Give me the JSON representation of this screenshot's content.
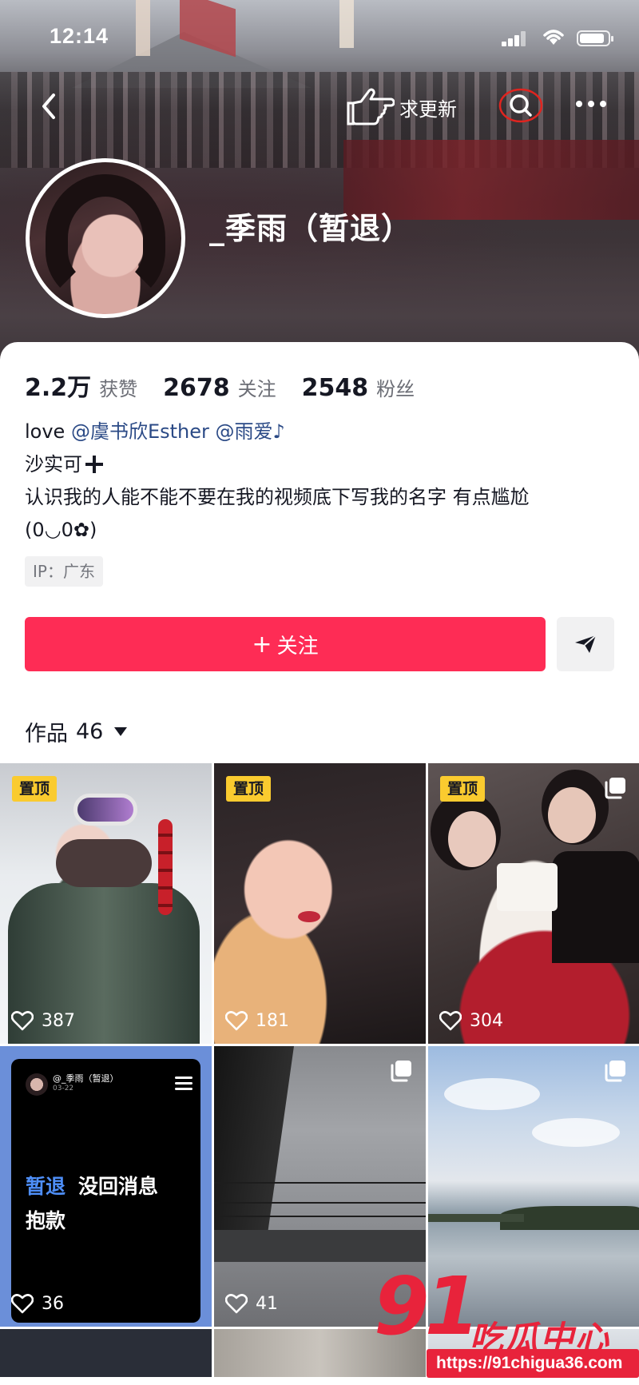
{
  "status_bar": {
    "time": "12:14"
  },
  "nav": {
    "request_update_label": "求更新",
    "icons": [
      "back-chevron-icon",
      "pointing-hand-icon",
      "search-icon",
      "more-dots-icon"
    ]
  },
  "profile": {
    "username": "_季雨（暂退）",
    "stats": [
      {
        "value": "2.2万",
        "label": "获赞"
      },
      {
        "value": "2678",
        "label": "关注"
      },
      {
        "value": "2548",
        "label": "粉丝"
      }
    ],
    "bio": {
      "line1_prefix": "love ",
      "mention1": "@虞书欣Esther",
      "mention2": "@雨爱♪",
      "line2": "沙实可",
      "line3": "认识我的人能不能不要在我的视频底下写我的名字 有点尴尬",
      "line4": "(0◡0✿)"
    },
    "ip_location": "IP：广东",
    "follow_button": {
      "plus": "+",
      "label": "关注"
    }
  },
  "works": {
    "title": "作品",
    "count": "46",
    "pin_label": "置顶",
    "tiles": [
      {
        "likes": "387",
        "pinned": true
      },
      {
        "likes": "181",
        "pinned": true
      },
      {
        "likes": "304",
        "pinned": true
      },
      {
        "likes": "36",
        "card_name": "@_季雨（暂退）",
        "card_date": "03-22",
        "card_highlight": "暂退",
        "card_text1": "没回消息",
        "card_text2": "抱款"
      },
      {
        "likes": "41"
      },
      {
        "likes": ""
      }
    ]
  },
  "watermark": {
    "logo_number": "91",
    "logo_text": "吃瓜中心",
    "url": "https://91chigua36.com"
  },
  "colors": {
    "follow_red": "#fe2c55",
    "pin_yellow": "#facb2f",
    "mention_blue": "#2b4a86",
    "watermark_red": "#e8233b"
  }
}
